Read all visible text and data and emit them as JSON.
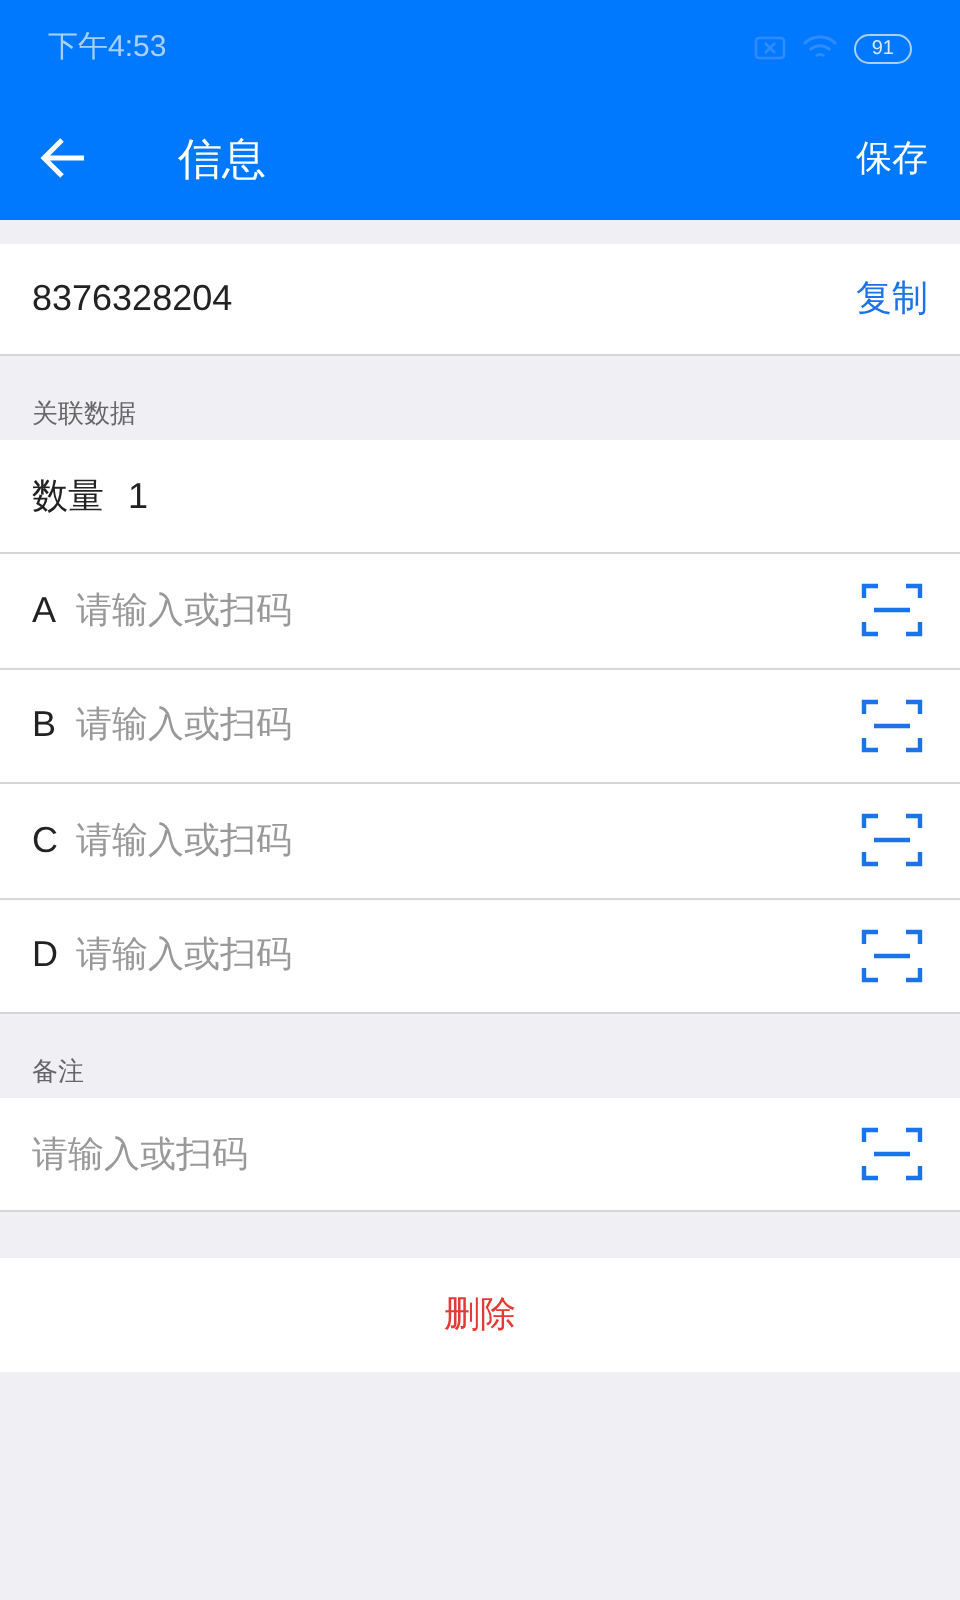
{
  "status_bar": {
    "time": "下午4:53",
    "battery": "91"
  },
  "header": {
    "title": "信息",
    "action": "保存"
  },
  "code": {
    "value": "8376328204",
    "action": "复制"
  },
  "related": {
    "heading": "关联数据",
    "quantity_label": "数量",
    "quantity": "1",
    "fields": [
      {
        "label": "A",
        "placeholder": "请输入或扫码"
      },
      {
        "label": "B",
        "placeholder": "请输入或扫码"
      },
      {
        "label": "C",
        "placeholder": "请输入或扫码"
      },
      {
        "label": "D",
        "placeholder": "请输入或扫码"
      }
    ]
  },
  "notes": {
    "heading": "备注",
    "placeholder": "请输入或扫码"
  },
  "delete_button": "删除"
}
